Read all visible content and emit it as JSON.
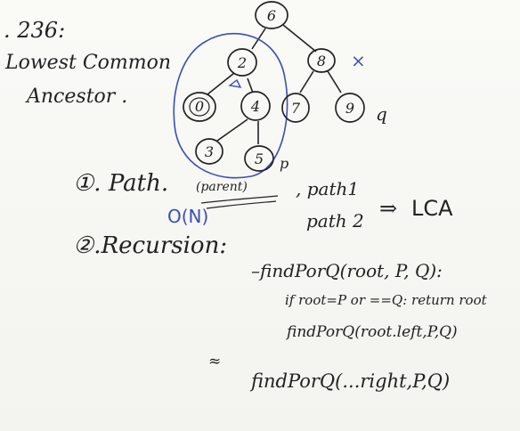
{
  "title": {
    "number": ". 236:",
    "line1": "Lowest Common",
    "line2": "Ancestor ."
  },
  "tree": {
    "nodes": [
      {
        "id": "n6",
        "label": "6"
      },
      {
        "id": "n2",
        "label": "2"
      },
      {
        "id": "n8",
        "label": "8"
      },
      {
        "id": "n0",
        "label": "0"
      },
      {
        "id": "n4",
        "label": "4"
      },
      {
        "id": "n7",
        "label": "7"
      },
      {
        "id": "n9",
        "label": "9"
      },
      {
        "id": "n3",
        "label": "3"
      },
      {
        "id": "n5",
        "label": "5"
      }
    ],
    "marks": {
      "q_label": "q",
      "p_label": "p",
      "x_label": "×"
    }
  },
  "method1": {
    "heading": "①. Path.",
    "parent_note": "(parent)",
    "path1": ", path1",
    "path2": "path 2",
    "arrow": "⇒",
    "result": "LCA",
    "complexity": "O(N)"
  },
  "method2": {
    "heading": "②.Recursion:",
    "line1": "–findPorQ(root, P, Q):",
    "line2": "if root=P or ==Q: return root",
    "line3": "findPorQ(root.left,P,Q)",
    "line4": "findPorQ(...right,P,Q)",
    "margin_mark": "≈"
  },
  "colors": {
    "ink": "#222222",
    "blue_ink": "#3c4fb0"
  }
}
